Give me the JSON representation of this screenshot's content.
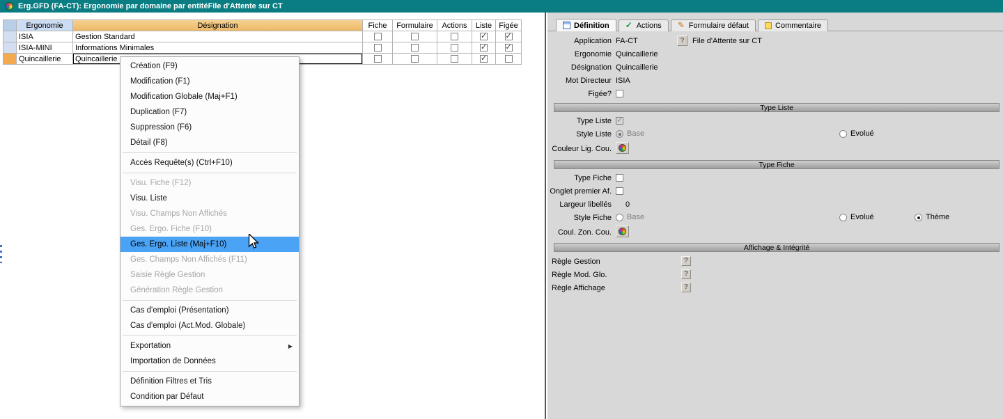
{
  "colors": {
    "titlebar": "#0a7d83",
    "menu_highlight": "#4aa3f5",
    "header_orange": "#eeb967",
    "header_blue": "#ccdcf2",
    "row_selector_blue": "#d3dff0",
    "row_selector_orange": "#f3a94f",
    "panel_bg": "#d8d8d8",
    "tab_check_green": "#1c9c3c"
  },
  "window": {
    "title": "Erg.GFD (FA-CT): Ergonomie par domaine par entitéFile d'Attente sur CT"
  },
  "table": {
    "headers": {
      "ergonomie": "Ergonomie",
      "designation": "Désignation",
      "fiche": "Fiche",
      "formulaire": "Formulaire",
      "actions": "Actions",
      "liste": "Liste",
      "figee": "Figée"
    },
    "rows": [
      {
        "ergonomie": "ISIA",
        "designation": "Gestion Standard",
        "fiche": false,
        "formulaire": false,
        "actions": false,
        "liste": true,
        "figee": true
      },
      {
        "ergonomie": "ISIA-MINI",
        "designation": "Informations Minimales",
        "fiche": false,
        "formulaire": false,
        "actions": false,
        "liste": true,
        "figee": true
      },
      {
        "ergonomie": "Quincaillerie",
        "designation": "Quincaillerie",
        "fiche": false,
        "formulaire": false,
        "actions": false,
        "liste": true,
        "figee": false,
        "editing": true
      }
    ]
  },
  "menu": {
    "items": [
      {
        "label": "Création (F9)",
        "state": ""
      },
      {
        "label": "Modification (F1)",
        "state": ""
      },
      {
        "label": "Modification Globale (Maj+F1)",
        "state": ""
      },
      {
        "label": "Duplication (F7)",
        "state": ""
      },
      {
        "label": "Suppression (F6)",
        "state": ""
      },
      {
        "label": "Détail (F8)",
        "state": ""
      },
      {
        "label": "Accès Requête(s) (Ctrl+F10)",
        "state": ""
      },
      {
        "label": "Visu. Fiche (F12)",
        "state": "disabled"
      },
      {
        "label": "Visu. Liste",
        "state": ""
      },
      {
        "label": "Visu. Champs Non Affichés",
        "state": "disabled"
      },
      {
        "label": "Ges. Ergo. Fiche (F10)",
        "state": "disabled"
      },
      {
        "label": "Ges. Ergo. Liste (Maj+F10)",
        "state": "highlighted"
      },
      {
        "label": "Ges. Champs Non Affichés (F11)",
        "state": "disabled"
      },
      {
        "label": "Saisie Règle Gestion",
        "state": "disabled"
      },
      {
        "label": "Génération Règle Gestion",
        "state": "disabled"
      },
      {
        "label": "Cas d'emploi (Présentation)",
        "state": ""
      },
      {
        "label": "Cas d'emploi (Act.Mod. Globale)",
        "state": ""
      },
      {
        "label": "Exportation",
        "state": "",
        "submenu": true
      },
      {
        "label": "Importation de Données",
        "state": ""
      },
      {
        "label": "Définition Filtres et Tris",
        "state": ""
      },
      {
        "label": "Condition par Défaut",
        "state": ""
      }
    ]
  },
  "panel": {
    "help": "?",
    "tabs": [
      {
        "label": "Définition",
        "active": true
      },
      {
        "label": "Actions"
      },
      {
        "label": "Formulaire défaut"
      },
      {
        "label": "Commentaire"
      }
    ],
    "sections": {
      "type_liste": "Type Liste",
      "type_fiche": "Type Fiche",
      "affichage": "Affichage & Intégrité"
    },
    "fields": {
      "application": {
        "label": "Application",
        "value": "FA-CT",
        "desc": "File d'Attente sur CT"
      },
      "ergonomie": {
        "label": "Ergonomie",
        "value": "Quincaillerie"
      },
      "designation": {
        "label": "Désignation",
        "value": "Quincaillerie"
      },
      "mot_directeur": {
        "label": "Mot Directeur",
        "value": "ISIA"
      },
      "figee": {
        "label": "Figée?",
        "checked": false
      },
      "type_liste": {
        "label": "Type Liste",
        "checked": true
      },
      "style_liste": {
        "label": "Style Liste",
        "options": [
          {
            "label": "Base",
            "selected": true
          },
          {
            "label": "Evolué",
            "selected": false
          }
        ]
      },
      "couleur_lig": {
        "label": "Couleur Lig. Cou."
      },
      "type_fiche": {
        "label": "Type Fiche",
        "checked": false
      },
      "onglet_premier": {
        "label": "Onglet premier Af.",
        "checked": false
      },
      "largeur_libelles": {
        "label": "Largeur libellés",
        "value": "0"
      },
      "style_fiche": {
        "label": "Style Fiche",
        "options": [
          {
            "label": "Base",
            "selected": false
          },
          {
            "label": "Evolué",
            "selected": false
          },
          {
            "label": "Thème",
            "selected": true
          }
        ]
      },
      "coul_zon": {
        "label": "Coul. Zon. Cou."
      },
      "regle_gestion": {
        "label": "Règle Gestion"
      },
      "regle_mod": {
        "label": "Règle Mod. Glo."
      },
      "regle_affichage": {
        "label": "Règle Affichage"
      }
    }
  }
}
